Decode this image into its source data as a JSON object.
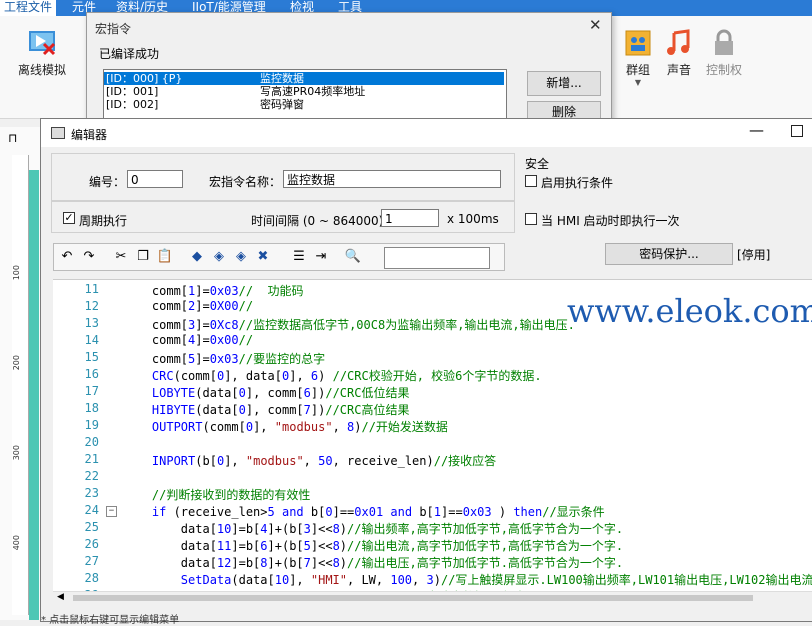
{
  "menubar": {
    "tabs": [
      "工程文件",
      "元件",
      "资料/历史",
      "IIoT/能源管理",
      "检视",
      "工具"
    ]
  },
  "ribbon": {
    "offline_sim": "离线模拟",
    "group": "群组",
    "sound": "声音",
    "control": "控制权"
  },
  "macro_dialog": {
    "title": "宏指令",
    "close": "✕",
    "compiled_label": "已编译成功",
    "rows": [
      {
        "id": "[ID：000] {P}",
        "name": "监控数据"
      },
      {
        "id": "[ID：001]",
        "name": "写高速PR04频率地址"
      },
      {
        "id": "[ID：002]",
        "name": "密码弹窗"
      }
    ],
    "new_button": "新增...",
    "delete_button": "删除"
  },
  "editor": {
    "title": "编辑器",
    "number_label": "编号：",
    "number_value": "0",
    "macro_name_label": "宏指令名称：",
    "macro_name_value": "监控数据",
    "security_label": "安全",
    "enable_condition": "启用执行条件",
    "periodic_label": "周期执行",
    "periodic_checked": true,
    "interval_label": "时间间隔 (0 ~ 864000)：",
    "interval_value": "1",
    "interval_unit": "x 100ms",
    "run_on_start": "当 HMI 启动时即执行一次",
    "password_button": "密码保护...",
    "password_status": "[停用]",
    "status_text": "* 点击鼠标右键可显示编辑菜单",
    "icons": [
      "undo-icon",
      "redo-icon",
      "cut-icon",
      "copy-icon",
      "paste-icon",
      "bookmark-toggle-icon",
      "bookmark-prev-icon",
      "bookmark-next-icon",
      "bookmark-clear-icon",
      "list-icon",
      "indent-icon",
      "find-icon"
    ]
  },
  "code": {
    "lines": [
      {
        "n": "11",
        "t": "    comm[1]=0x03//  功能码"
      },
      {
        "n": "12",
        "t": "    comm[2]=0X00//"
      },
      {
        "n": "13",
        "t": "    comm[3]=0Xc8//监控数据高低字节,00C8为监输出频率,输出电流,输出电压."
      },
      {
        "n": "14",
        "t": "    comm[4]=0x00//"
      },
      {
        "n": "15",
        "t": "    comm[5]=0x03//要监控的总字"
      },
      {
        "n": "16",
        "t": "    CRC(comm[0], data[0], 6) //CRC校验开始, 校验6个字节的数据."
      },
      {
        "n": "17",
        "t": "    LOBYTE(data[0], comm[6])//CRC低位结果"
      },
      {
        "n": "18",
        "t": "    HIBYTE(data[0], comm[7])//CRC高位结果"
      },
      {
        "n": "19",
        "t": "    OUTPORT(comm[0], \"modbus\", 8)//开始发送数据"
      },
      {
        "n": "20",
        "t": ""
      },
      {
        "n": "21",
        "t": "    INPORT(b[0], \"modbus\", 50, receive_len)//接收应答"
      },
      {
        "n": "22",
        "t": ""
      },
      {
        "n": "23",
        "t": "    //判断接收到的数据的有效性"
      },
      {
        "n": "24",
        "t": "    if (receive_len>5 and b[0]==0x01 and b[1]==0x03 ) then//显示条件"
      },
      {
        "n": "25",
        "t": "        data[10]=b[4]+(b[3]<<8)//输出频率,高字节加低字节,高低字节合为一个字."
      },
      {
        "n": "26",
        "t": "        data[11]=b[6]+(b[5]<<8)//输出电流,高字节加低字节,高低字节合为一个字."
      },
      {
        "n": "27",
        "t": "        data[12]=b[8]+(b[7]<<8)//输出电压,高字节加低字节.高低字节合为一个字."
      },
      {
        "n": "28",
        "t": "        SetData(data[10], \"HMI\", LW, 100, 3)//写上触摸屏显示.LW100输出频率,LW101输出电压,LW102输出电流"
      },
      {
        "n": "29",
        "t": "                                        //当读出数据正确时下面"
      }
    ]
  },
  "ruler": {
    "ticks": [
      "100",
      "200",
      "300",
      "400",
      "500"
    ]
  },
  "watermark": "www.eleok.com",
  "colors": {
    "accent": "#2b7bd5",
    "selection": "#0078d7",
    "line_number": "#2b91af",
    "comment": "#008000",
    "keyword": "#0000ff",
    "string": "#a31515"
  }
}
